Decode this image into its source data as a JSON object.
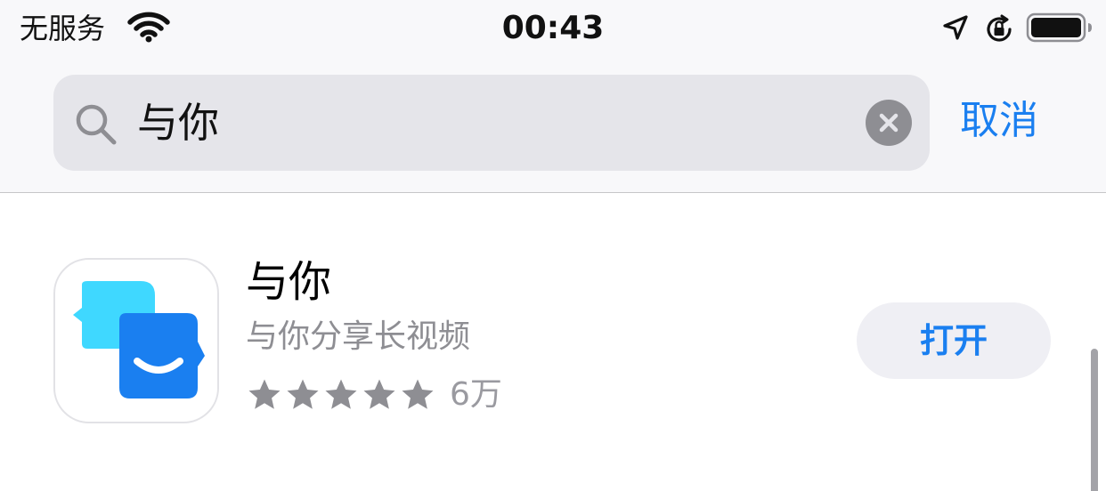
{
  "status_bar": {
    "carrier": "无服务",
    "time": "00:43",
    "icons": [
      "wifi-icon",
      "location-arrow-icon",
      "orientation-lock-icon",
      "battery-icon"
    ]
  },
  "search": {
    "query": "与你",
    "cancel_label": "取消"
  },
  "result": {
    "name": "与你",
    "subtitle": "与你分享长视频",
    "rating_stars": 5,
    "rating_count": "6万",
    "open_label": "打开"
  },
  "colors": {
    "accent": "#1a7ff0",
    "icon_front": "#1a7ff0",
    "icon_back": "#3fd8ff"
  }
}
